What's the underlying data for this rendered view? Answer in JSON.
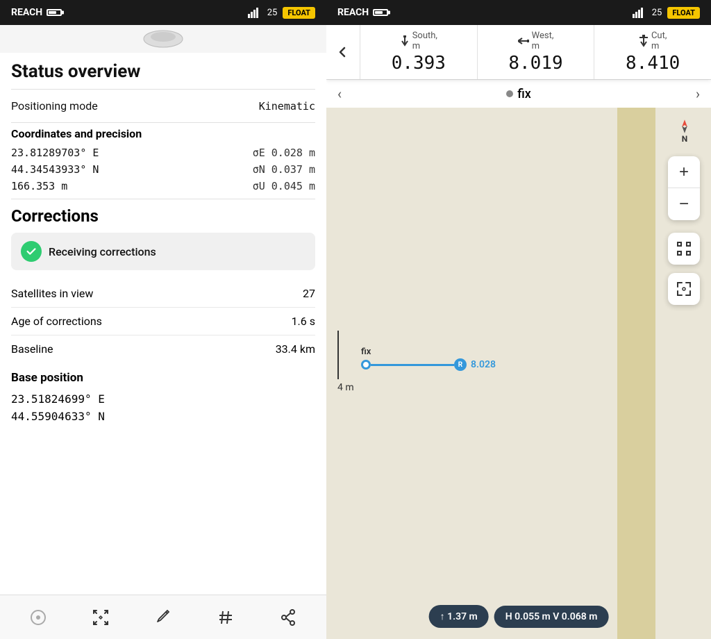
{
  "left": {
    "statusBar": {
      "appName": "REACH",
      "satellites": "25",
      "badge": "FLOAT"
    },
    "pageTitle": "Status overview",
    "positioningMode": {
      "label": "Positioning mode",
      "value": "Kinematic"
    },
    "coordsSection": {
      "heading": "Coordinates and precision",
      "lon": "23.81289703° E",
      "lonSigma": "σE 0.028 m",
      "lat": "44.34543933° N",
      "latSigma": "σN 0.037 m",
      "alt": "166.353 m",
      "altSigma": "σU 0.045 m"
    },
    "corrections": {
      "heading": "Corrections",
      "receivingText": "Receiving corrections",
      "rows": [
        {
          "label": "Satellites in view",
          "value": "27"
        },
        {
          "label": "Age of corrections",
          "value": "1.6 s"
        },
        {
          "label": "Baseline",
          "value": "33.4 km"
        }
      ]
    },
    "basePosition": {
      "heading": "Base position",
      "lon": "23.51824699° E",
      "lat": "44.55904633° N"
    }
  },
  "right": {
    "statusBar": {
      "appName": "REACH",
      "satellites": "25",
      "badge": "FLOAT"
    },
    "navColumns": [
      {
        "direction": "South,",
        "unit": "m",
        "value": "0.393",
        "arrowDir": "down"
      },
      {
        "direction": "West,",
        "unit": "m",
        "value": "8.019",
        "arrowDir": "left"
      },
      {
        "direction": "Cut,",
        "unit": "m",
        "value": "8.410",
        "arrowDir": "down"
      }
    ],
    "fixBar": {
      "status": "fix"
    },
    "map": {
      "scaleLabel": "4 m",
      "compassN": "N",
      "fixLabel": "fix",
      "distanceLabel": "8.028",
      "refLabel": "R"
    },
    "bottomBar": {
      "arrow": "↑ 1.37 m",
      "precision": "H 0.055 m  V 0.068 m"
    },
    "zoomIn": "+",
    "zoomOut": "−"
  }
}
